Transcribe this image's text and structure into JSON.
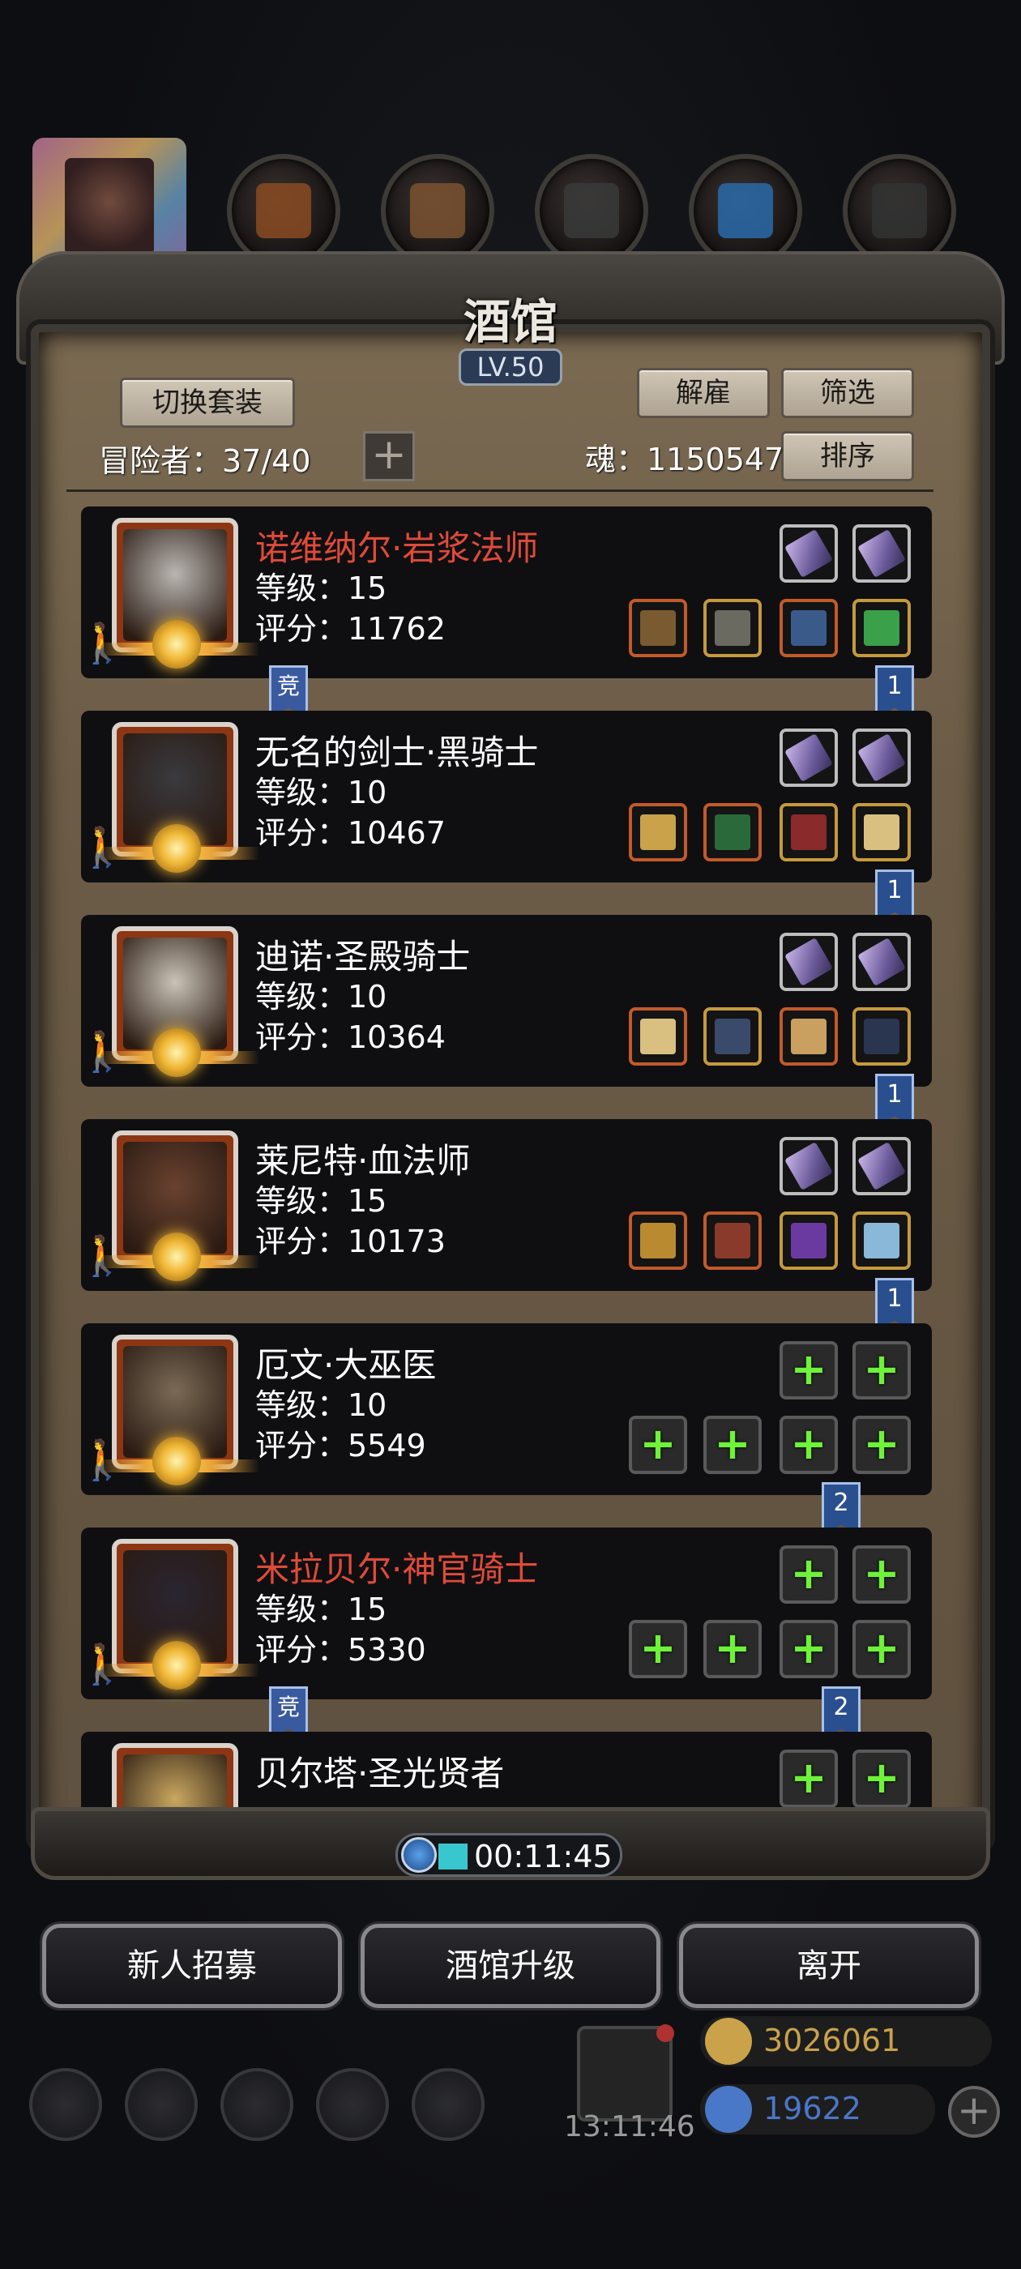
{
  "panel": {
    "title": "酒馆",
    "level": "LV.50",
    "switch_outfit_label": "切换套装",
    "dismiss_label": "解雇",
    "filter_label": "筛选",
    "sort_label": "排序",
    "adventurers_label": "冒险者：37/40",
    "soul_label": "魂：1150547",
    "add_label": "+"
  },
  "heroes": [
    {
      "name": "诺维纳尔·岩浆法师",
      "level": "等级：15",
      "score": "评分：11762",
      "name_color": "#e04a3a",
      "ribbon": "1",
      "competitive": "竞",
      "equipped": true,
      "portrait_color": "#b9b6b2"
    },
    {
      "name": "无名的剑士·黑骑士",
      "level": "等级：10",
      "score": "评分：10467",
      "name_color": "#ffffff",
      "ribbon": "1",
      "equipped": true,
      "portrait_color": "#3a3a3e"
    },
    {
      "name": "迪诺·圣殿骑士",
      "level": "等级：10",
      "score": "评分：10364",
      "name_color": "#ffffff",
      "ribbon": "1",
      "equipped": true,
      "portrait_color": "#c9c3b6"
    },
    {
      "name": "莱尼特·血法师",
      "level": "等级：15",
      "score": "评分：10173",
      "name_color": "#ffffff",
      "ribbon": "1",
      "equipped": true,
      "portrait_color": "#6a4230"
    },
    {
      "name": "厄文·大巫医",
      "level": "等级：10",
      "score": "评分：5549",
      "name_color": "#ffffff",
      "ribbon": "2",
      "equipped": false,
      "portrait_color": "#7a6a55"
    },
    {
      "name": "米拉贝尔·神官骑士",
      "level": "等级：15",
      "score": "评分：5330",
      "name_color": "#e04a3a",
      "ribbon": "2",
      "competitive": "竞",
      "equipped": false,
      "portrait_color": "#2a2530"
    },
    {
      "name": "贝尔塔·圣光贤者",
      "level": "",
      "score": "",
      "name_color": "#ffffff",
      "ribbon": "",
      "equipped": false,
      "portrait_color": "#c9a860"
    }
  ],
  "timer": {
    "value": "00:11:45"
  },
  "actions": {
    "recruit_label": "新人招募",
    "upgrade_label": "酒馆升级",
    "leave_label": "离开"
  },
  "hud": {
    "clock": "13:11:46",
    "gold": "3026061",
    "gems": "19622",
    "gold_color": "#c9a24a",
    "gem_color": "#4a78c8"
  },
  "icons": [
    "crystal-icon",
    "staff-icon",
    "armor-icon",
    "amulet-icon",
    "ring-icon",
    "sword-icon",
    "hammer-icon",
    "plus-icon",
    "clock-icon",
    "gift-icon",
    "gold-coin-icon",
    "gem-icon"
  ]
}
